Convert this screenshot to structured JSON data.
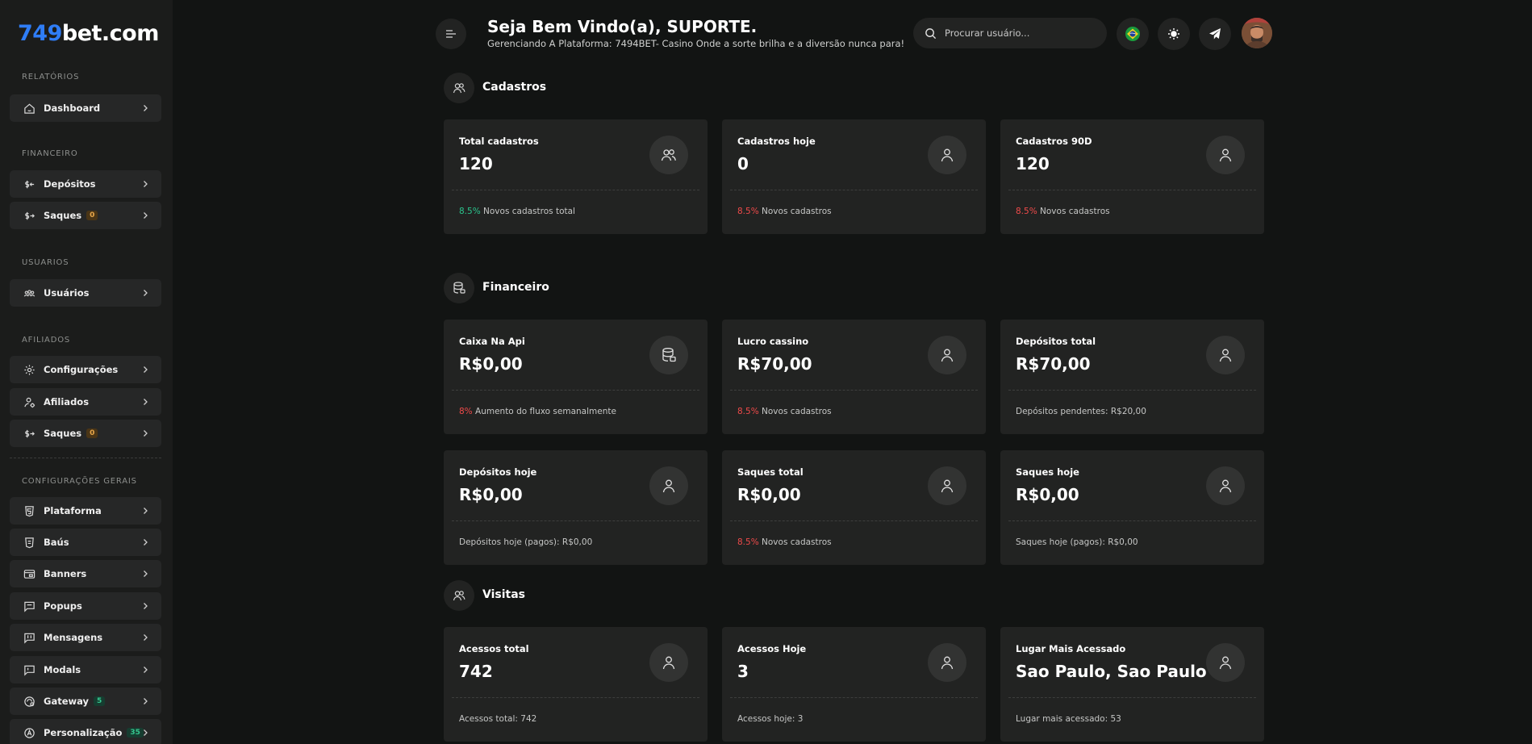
{
  "sidebar": {
    "logo": {
      "accent": "749",
      "rest": "bet.com"
    },
    "sections": {
      "relatorios": "RELATÓRIOS",
      "financeiro": "FINANCEIRO",
      "usuarios": "USUARIOS",
      "afiliados": "AFILIADOS",
      "config_gerais": "CONFIGURAÇÕES GERAIS"
    },
    "items": {
      "dashboard": "Dashboard",
      "depositos": "Depósitos",
      "saques": "Saques",
      "saques_badge": "0",
      "usuarios": "Usuários",
      "configuracoes": "Configurações",
      "afiliados": "Afiliados",
      "afil_saques": "Saques",
      "afil_saques_badge": "0",
      "plataforma": "Plataforma",
      "baus": "Baús",
      "banners": "Banners",
      "popups": "Popups",
      "mensagens": "Mensagens",
      "modals": "Modals",
      "gateway": "Gateway",
      "gateway_badge": "5",
      "personalizacao": "Personalização",
      "personalizacao_badge": "35"
    }
  },
  "header": {
    "welcome": "Seja Bem Vindo(a), SUPORTE.",
    "subtitle": "Gerenciando A Plataforma: 7494BET- Casino Onde a sorte brilha e a diversão nunca para!",
    "search_placeholder": "Procurar usuário..."
  },
  "sections": {
    "cadastros": "Cadastros",
    "financeiro": "Financeiro",
    "visitas": "Visitas"
  },
  "cards": {
    "total_cadastros": {
      "label": "Total cadastros",
      "value": "120",
      "pct": "8.5%",
      "footer": " Novos cadastros total"
    },
    "cadastros_hoje": {
      "label": "Cadastros hoje",
      "value": "0",
      "pct": "8.5%",
      "footer": " Novos cadastros"
    },
    "cadastros_90d": {
      "label": "Cadastros 90D",
      "value": "120",
      "pct": "8.5%",
      "footer": " Novos cadastros"
    },
    "caixa_api": {
      "label": "Caixa Na Api",
      "value": "R$0,00",
      "pct": "8%",
      "footer": " Aumento do fluxo semanalmente"
    },
    "lucro_cassino": {
      "label": "Lucro cassino",
      "value": "R$70,00",
      "pct": "8.5%",
      "footer": " Novos cadastros"
    },
    "depositos_total": {
      "label": "Depósitos total",
      "value": "R$70,00",
      "footer": "Depósitos pendentes: R$20,00"
    },
    "depositos_hoje": {
      "label": "Depósitos hoje",
      "value": "R$0,00",
      "footer": "Depósitos hoje (pagos): R$0,00"
    },
    "saques_total": {
      "label": "Saques total",
      "value": "R$0,00",
      "pct": "8.5%",
      "footer": " Novos cadastros"
    },
    "saques_hoje": {
      "label": "Saques hoje",
      "value": "R$0,00",
      "footer": "Saques hoje (pagos): R$0,00"
    },
    "acessos_total": {
      "label": "Acessos total",
      "value": "742",
      "footer": "Acessos total: 742"
    },
    "acessos_hoje": {
      "label": "Acessos Hoje",
      "value": "3",
      "footer": "Acessos hoje: 3"
    },
    "lugar_mais": {
      "label": "Lugar Mais Acessado",
      "value": "Sao Paulo, Sao Paulo",
      "footer": "Lugar mais acessado: 53"
    }
  },
  "colors": {
    "accent_blue": "#2f7df6",
    "positive": "#2bc48d",
    "negative": "#ef4a4a",
    "badge_orange": "#e7a64a"
  }
}
